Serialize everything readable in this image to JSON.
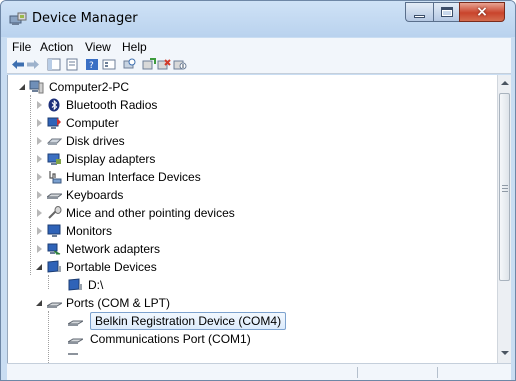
{
  "window": {
    "title": "Device Manager",
    "controls": {
      "minimize": "minimize",
      "maximize": "maximize",
      "close": "x"
    }
  },
  "menu": [
    "File",
    "Action",
    "View",
    "Help"
  ],
  "toolbar": {
    "icons": [
      "back-arrow-icon",
      "forward-arrow-icon",
      "show-hide-console-tree-icon",
      "properties-icon",
      "help-icon",
      "view-icon",
      "scan-hardware-icon",
      "update-driver-icon",
      "uninstall-icon",
      "disable-device-icon"
    ]
  },
  "tree": {
    "root": "Computer2-PC",
    "items": [
      {
        "label": "Bluetooth Radios",
        "icon": "bluetooth-icon",
        "state": "collapsed"
      },
      {
        "label": "Computer",
        "icon": "computer-icon",
        "state": "collapsed"
      },
      {
        "label": "Disk drives",
        "icon": "disk-drive-icon",
        "state": "collapsed"
      },
      {
        "label": "Display adapters",
        "icon": "display-adapter-icon",
        "state": "collapsed"
      },
      {
        "label": "Human Interface Devices",
        "icon": "hid-icon",
        "state": "collapsed"
      },
      {
        "label": "Keyboards",
        "icon": "keyboard-icon",
        "state": "collapsed"
      },
      {
        "label": "Mice and other pointing devices",
        "icon": "mouse-icon",
        "state": "collapsed"
      },
      {
        "label": "Monitors",
        "icon": "monitor-icon",
        "state": "collapsed"
      },
      {
        "label": "Network adapters",
        "icon": "network-adapter-icon",
        "state": "collapsed"
      },
      {
        "label": "Portable Devices",
        "icon": "portable-device-icon",
        "state": "expanded",
        "children": [
          {
            "label": "D:\\",
            "icon": "portable-device-icon"
          }
        ]
      },
      {
        "label": "Ports (COM & LPT)",
        "icon": "port-icon",
        "state": "expanded",
        "children": [
          {
            "label": "Belkin Registration Device (COM4)",
            "icon": "port-icon",
            "selected": true
          },
          {
            "label": "Communications Port (COM1)",
            "icon": "port-icon"
          }
        ]
      }
    ]
  },
  "colors": {
    "title_bar": "#c4daf2",
    "selection_border": "#7da2ce",
    "close_button": "#c9442c"
  }
}
